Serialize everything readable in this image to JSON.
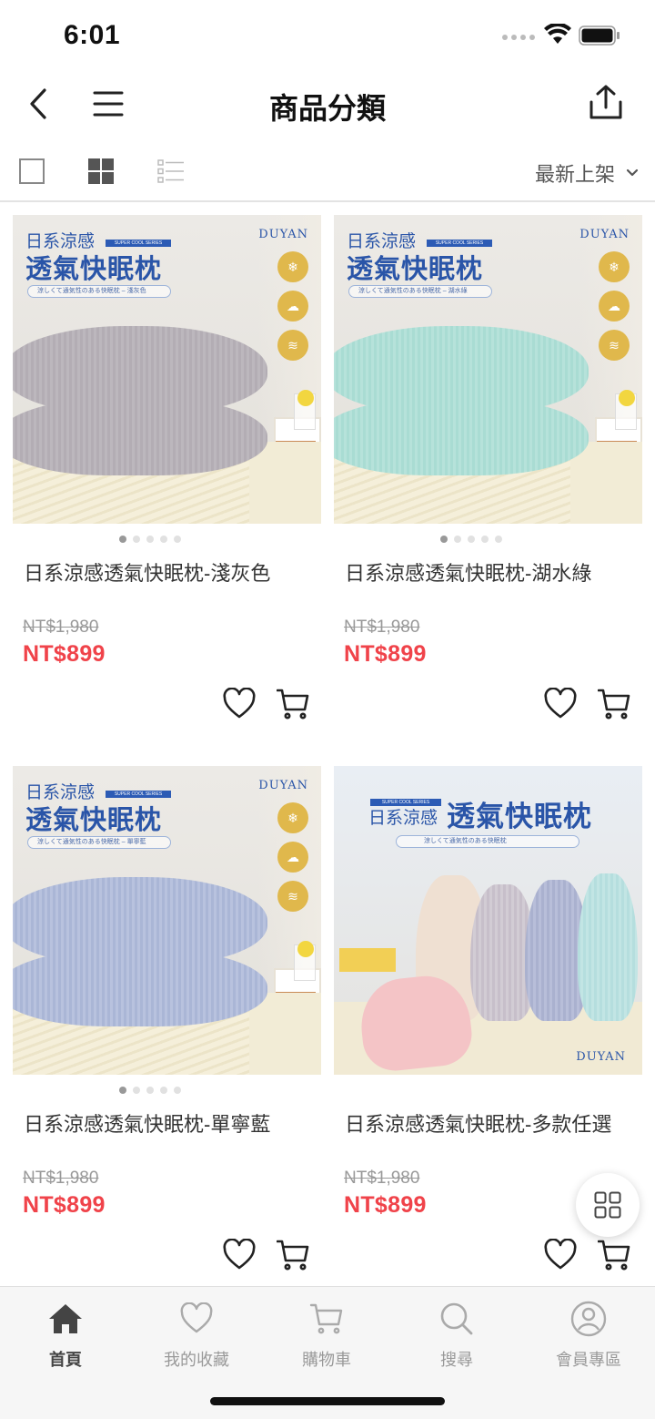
{
  "status": {
    "time": "6:01"
  },
  "nav": {
    "title": "商品分類"
  },
  "toolbar": {
    "sort_label": "最新上架"
  },
  "colors": {
    "accent": "#f0434a",
    "brand_blue": "#2a55a8",
    "badge_gold": "#e0b84c"
  },
  "products": [
    {
      "name": "日系涼感透氣快眠枕-淺灰色",
      "original_price": "NT$1,980",
      "price": "NT$899",
      "image": {
        "title_small": "日系涼感",
        "series": "SUPER COOL SERIES",
        "title_big": "透氣快眠枕",
        "subtitle": "涼しくて通気性のある快眠枕 – 淺灰色",
        "brand": "DUYAN",
        "pillow_color": "#b3adb4"
      },
      "carousel_dots": 5
    },
    {
      "name": "日系涼感透氣快眠枕-湖水綠",
      "original_price": "NT$1,980",
      "price": "NT$899",
      "image": {
        "title_small": "日系涼感",
        "series": "SUPER COOL SERIES",
        "title_big": "透氣快眠枕",
        "subtitle": "涼しくて通気性のある快眠枕 – 湖水綠",
        "brand": "DUYAN",
        "pillow_color": "#a9dcd3"
      },
      "carousel_dots": 5
    },
    {
      "name": "日系涼感透氣快眠枕-單寧藍",
      "original_price": "NT$1,980",
      "price": "NT$899",
      "image": {
        "title_small": "日系涼感",
        "series": "SUPER COOL SERIES",
        "title_big": "透氣快眠枕",
        "subtitle": "涼しくて通気性のある快眠枕 – 單寧藍",
        "brand": "DUYAN",
        "pillow_color": "#aab6d6"
      },
      "carousel_dots": 5
    },
    {
      "name": "日系涼感透氣快眠枕-多款任選",
      "original_price": "NT$1,980",
      "price": "NT$899",
      "image": {
        "title_small": "日系涼感",
        "series": "SUPER COOL SERIES",
        "title_big": "透氣快眠枕",
        "subtitle": "涼しくて通気性のある快眠枕",
        "brand": "DUYAN"
      },
      "carousel_dots": 0
    }
  ],
  "tabs": [
    {
      "label": "首頁",
      "icon": "home-icon",
      "active": true
    },
    {
      "label": "我的收藏",
      "icon": "heart-icon",
      "active": false
    },
    {
      "label": "購物車",
      "icon": "cart-icon",
      "active": false
    },
    {
      "label": "搜尋",
      "icon": "search-icon",
      "active": false
    },
    {
      "label": "會員專區",
      "icon": "user-icon",
      "active": false
    }
  ]
}
